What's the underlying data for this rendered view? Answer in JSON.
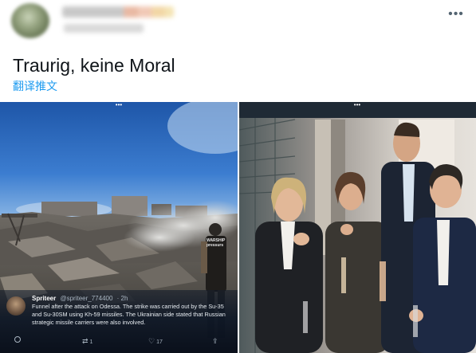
{
  "tweet": {
    "text": "Traurig, keine Moral",
    "translate_label": "翻译推文"
  },
  "icons": {
    "more": "more-horizontal-icon",
    "reply": "reply-icon",
    "retweet": "retweet-icon",
    "like": "like-icon",
    "share": "share-icon"
  },
  "embedded_tweet": {
    "name": "Spriteer",
    "handle": "@spriteer_774400",
    "time": "· 2h",
    "body": "Funnel after the attack on Odessa. The strike was carried out by the Su-35 and Su-30SM using Kh-59 missiles. The Ukrainian side stated that Russian strategic missile carriers were also involved.",
    "reply_count": "",
    "retweet_count": "1",
    "like_count": "17",
    "vest_text": "WARSHIP\npressurs"
  }
}
